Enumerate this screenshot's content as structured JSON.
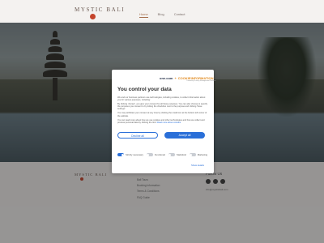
{
  "site": {
    "name": "MYSTIC BALI"
  },
  "nav": {
    "items": [
      {
        "label": "Home"
      },
      {
        "label": "Blog"
      },
      {
        "label": "Contact"
      }
    ]
  },
  "consent": {
    "brand": {
      "part1": "one.com",
      "sep": "+",
      "part2": "COOKIEINFORMATION",
      "sub": "Trusted by Privacy Management Platform"
    },
    "title": "You control your data",
    "paragraph1": "We and our business partners use technologies, including cookies, to collect information about you for various purposes, including:",
    "paragraph2": "By clicking 'Accept', you give your consent for all these purposes. You can also choose to specify the purposes you consent to by ticking the checkbox next to the purpose and clicking 'Save settings'.",
    "paragraph3": "You may withdraw your consent at any time by clicking the small icon at the bottom left corner of the website.",
    "paragraph4": "You can read more about how we use cookies and other technologies and how we collect and process personal data by clicking the link.",
    "link": "Read more about cookies",
    "decline_label": "Decline all",
    "accept_label": "Accept all",
    "toggles": [
      {
        "label": "Strictly necessary",
        "on": true
      },
      {
        "label": "Functional",
        "on": false
      },
      {
        "label": "Statistical",
        "on": false
      },
      {
        "label": "Marketing",
        "on": false
      }
    ],
    "show_details": "Show details"
  },
  "footer": {
    "logo": "MYSTIC BALI",
    "links": [
      {
        "label": "Bali Tours"
      },
      {
        "label": "Booking Information"
      },
      {
        "label": "Terms & Conditions"
      },
      {
        "label": "FAQ Guide"
      }
    ],
    "follow": "Follow Us",
    "email": "info@mysticbali.com"
  }
}
